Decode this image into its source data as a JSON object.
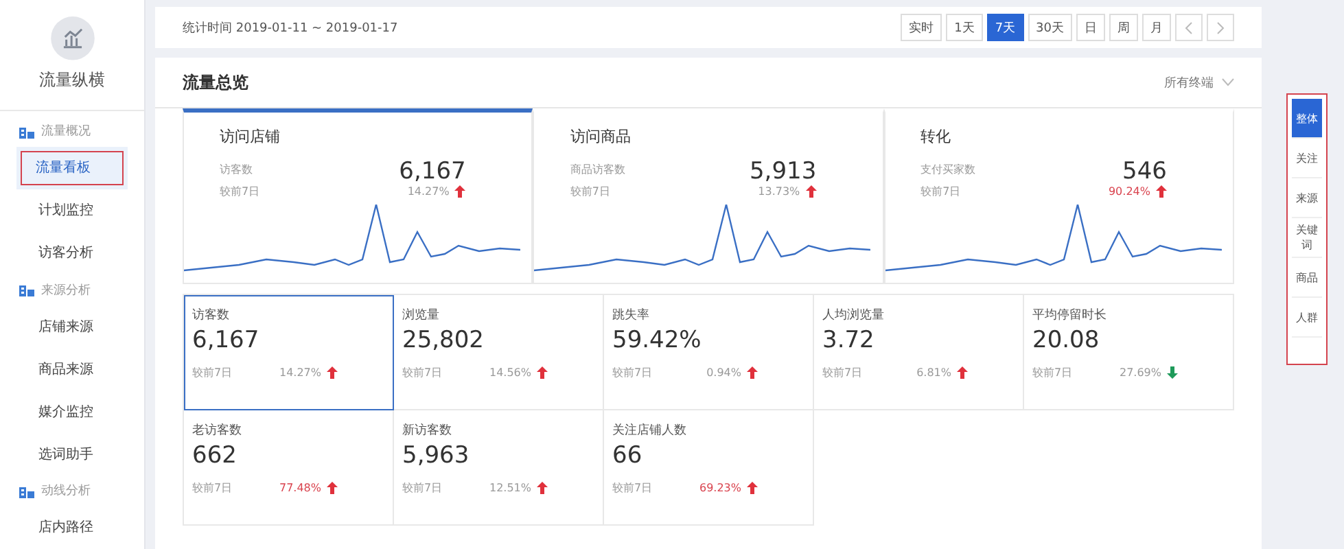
{
  "sidebar": {
    "title": "流量纵横",
    "sections": [
      {
        "label": "流量概况",
        "items": [
          {
            "label": "流量看板",
            "selected": true
          },
          {
            "label": "计划监控",
            "selected": false
          },
          {
            "label": "访客分析",
            "selected": false
          }
        ]
      },
      {
        "label": "来源分析",
        "items": [
          {
            "label": "店铺来源",
            "selected": false
          },
          {
            "label": "商品来源",
            "selected": false
          },
          {
            "label": "媒介监控",
            "selected": false
          },
          {
            "label": "选词助手",
            "selected": false
          }
        ]
      },
      {
        "label": "动线分析",
        "items": [
          {
            "label": "店内路径",
            "selected": false
          }
        ]
      }
    ]
  },
  "toolbar": {
    "date_range": "统计时间 2019-01-11 ~ 2019-01-17",
    "periods": [
      {
        "label": "实时",
        "selected": false
      },
      {
        "label": "1天",
        "selected": false
      },
      {
        "label": "7天",
        "selected": true
      },
      {
        "label": "30天",
        "selected": false
      },
      {
        "label": "日",
        "selected": false
      },
      {
        "label": "周",
        "selected": false
      },
      {
        "label": "月",
        "selected": false
      }
    ]
  },
  "overview": {
    "title": "流量总览",
    "terminal_filter": "所有终端",
    "cards": [
      {
        "title": "访问店铺",
        "metric": "访客数",
        "compare": "较前7日",
        "value": "6,167",
        "change": "14.27%",
        "rising": true,
        "emphasized": false,
        "selected": true
      },
      {
        "title": "访问商品",
        "metric": "商品访客数",
        "compare": "较前7日",
        "value": "5,913",
        "change": "13.73%",
        "rising": true,
        "emphasized": false,
        "selected": false
      },
      {
        "title": "转化",
        "metric": "支付买家数",
        "compare": "较前7日",
        "value": "546",
        "change": "90.24%",
        "rising": true,
        "emphasized": true,
        "selected": false
      }
    ]
  },
  "metrics": [
    {
      "label": "访客数",
      "value": "6,167",
      "compare": "较前7日",
      "change": "14.27%",
      "rising": true,
      "emphasized": false,
      "selected": true
    },
    {
      "label": "浏览量",
      "value": "25,802",
      "compare": "较前7日",
      "change": "14.56%",
      "rising": true,
      "emphasized": false,
      "selected": false
    },
    {
      "label": "跳失率",
      "value": "59.42%",
      "compare": "较前7日",
      "change": "0.94%",
      "rising": true,
      "emphasized": false,
      "selected": false
    },
    {
      "label": "人均浏览量",
      "value": "3.72",
      "compare": "较前7日",
      "change": "6.81%",
      "rising": true,
      "emphasized": false,
      "selected": false
    },
    {
      "label": "平均停留时长",
      "value": "20.08",
      "compare": "较前7日",
      "change": "27.69%",
      "rising": false,
      "emphasized": false,
      "selected": false
    },
    {
      "label": "老访客数",
      "value": "662",
      "compare": "较前7日",
      "change": "77.48%",
      "rising": true,
      "emphasized": true,
      "selected": false
    },
    {
      "label": "新访客数",
      "value": "5,963",
      "compare": "较前7日",
      "change": "12.51%",
      "rising": true,
      "emphasized": false,
      "selected": false
    },
    {
      "label": "关注店铺人数",
      "value": "66",
      "compare": "较前7日",
      "change": "69.23%",
      "rising": true,
      "emphasized": true,
      "selected": false
    }
  ],
  "side_tabs": [
    {
      "label": "整体",
      "selected": true
    },
    {
      "label": "关注",
      "selected": false
    },
    {
      "label": "来源",
      "selected": false
    },
    {
      "label": "关键词",
      "selected": false
    },
    {
      "label": "商品",
      "selected": false
    },
    {
      "label": "人群",
      "selected": false
    }
  ]
}
